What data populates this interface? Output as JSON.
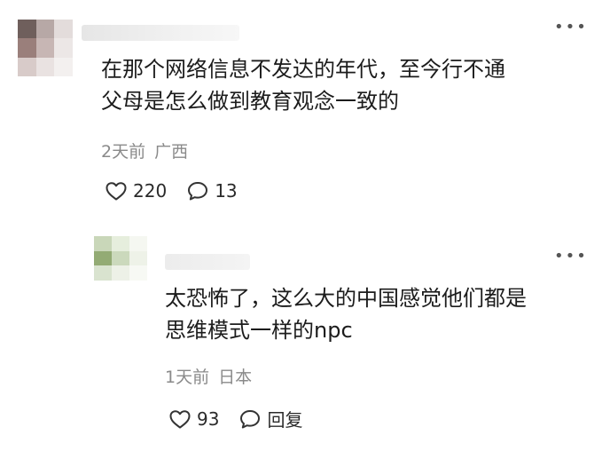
{
  "comments": [
    {
      "content_line1": "在那个网络信息不发达的年代，至今行不通",
      "content_line2": "父母是怎么做到教育观念一致的",
      "time": "2天前",
      "location": "广西",
      "likes": "220",
      "replies": "13",
      "avatar_colors": [
        "#6f5f5c",
        "#b7a8a6",
        "#e3dcdb",
        "#9a7f7b",
        "#c7b6b4",
        "#ece7e6",
        "#d8cbc9",
        "#e9e2e1",
        "#f3f0ef"
      ]
    },
    {
      "content_line1": "太恐怖了，这么大的中国感觉他们都是",
      "content_line2": "思维模式一样的npc",
      "time": "1天前",
      "location": "日本",
      "likes": "93",
      "reply_label": "回复",
      "avatar_colors": [
        "#c9d7b9",
        "#e6eedd",
        "#f5f7f1",
        "#93ab74",
        "#cbd9bc",
        "#eef2e8",
        "#d9e3cf",
        "#edf1e7",
        "#f7f9f4"
      ]
    }
  ],
  "icons": {
    "like": "heart-outline-icon",
    "comment": "speech-bubble-icon",
    "more": "more-dots-icon"
  }
}
